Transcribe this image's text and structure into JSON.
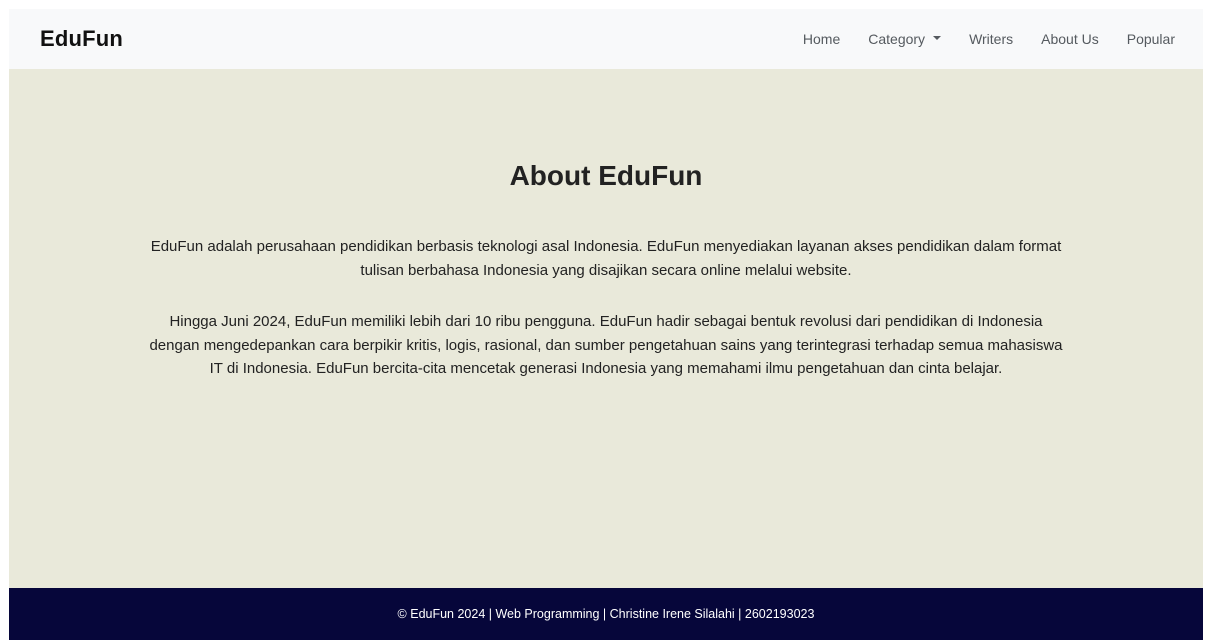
{
  "navbar": {
    "brand": "EduFun",
    "links": [
      {
        "label": "Home"
      },
      {
        "label": "Category",
        "has_dropdown": true
      },
      {
        "label": "Writers"
      },
      {
        "label": "About Us"
      },
      {
        "label": "Popular"
      }
    ]
  },
  "main": {
    "title": "About EduFun",
    "paragraphs": [
      "EduFun adalah perusahaan pendidikan berbasis teknologi asal Indonesia. EduFun menyediakan layanan akses pendidikan dalam format tulisan berbahasa Indonesia yang disajikan secara online melalui website.",
      "Hingga Juni 2024, EduFun memiliki lebih dari 10 ribu pengguna. EduFun hadir sebagai bentuk revolusi dari pendidikan di Indonesia dengan mengedepankan cara berpikir kritis, logis, rasional, dan sumber pengetahuan sains yang terintegrasi terhadap semua mahasiswa IT di Indonesia. EduFun bercita-cita mencetak generasi Indonesia yang memahami ilmu pengetahuan dan cinta belajar."
    ]
  },
  "footer": {
    "text": "© EduFun 2024 | Web Programming | Christine Irene Silalahi | 2602193023"
  },
  "colors": {
    "navbar_bg": "#f8f9fa",
    "content_bg": "#e9e9da",
    "footer_bg": "#06063a"
  }
}
